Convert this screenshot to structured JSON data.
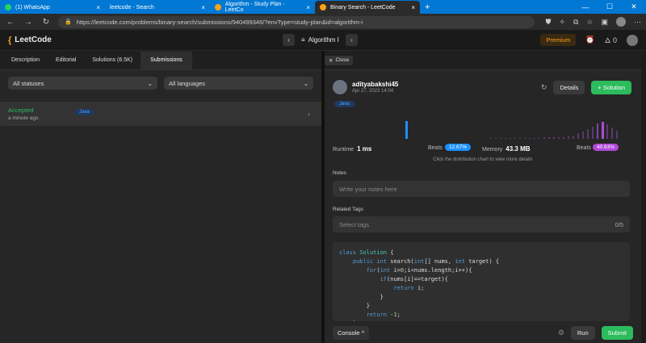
{
  "browser": {
    "tabs": [
      {
        "title": "(1) WhatsApp"
      },
      {
        "title": "leetcode - Search"
      },
      {
        "title": "Algorithm - Study Plan - LeetCo"
      },
      {
        "title": "Binary Search - LeetCode"
      }
    ],
    "url": "https://leetcode.com/problems/binary-search/submissions/940499346/?envType=study-plan&id=algorithm-i"
  },
  "header": {
    "logo": "LeetCode",
    "plan_title": "Algorithm I",
    "premium": "Premium",
    "streak": "0"
  },
  "left": {
    "tabs": [
      "Description",
      "Editorial",
      "Solutions (6.5K)",
      "Submissions"
    ],
    "filters": {
      "status": "All statuses",
      "language": "All languages"
    },
    "submission": {
      "status": "Accepted",
      "time": "a minute ago",
      "language": "Java"
    }
  },
  "right": {
    "close_label": "Close",
    "user": {
      "name": "adityabakshi45",
      "date": "Apr 27, 2023 14:04"
    },
    "details_label": "Details",
    "solution_label": "+ Solution",
    "language": "Java",
    "runtime": {
      "label": "Runtime",
      "value": "1 ms",
      "beats_label": "Beats",
      "beats": "12.67%"
    },
    "memory": {
      "label": "Memory",
      "value": "43.3 MB",
      "beats_label": "Beats",
      "beats": "40.63%"
    },
    "hint": "Click the distribution chart to view more details",
    "notes_label": "Notes",
    "notes_placeholder": "Write your notes here",
    "tags_label": "Related Tags",
    "tags_placeholder": "Select tags",
    "tags_count": "0/5",
    "console_label": "Console ^",
    "run_label": "Run",
    "submit_label": "Submit"
  },
  "code_lines": [
    "class Solution {",
    "    public int search(int[] nums, int target) {",
    "        for(int i=0;i<nums.length;i++){",
    "            if(nums[i]==target){",
    "                return i;",
    "            }",
    "        }",
    "        return -1;",
    "    }"
  ],
  "colors": {
    "accent": "#ffa116",
    "green": "#2cbb5d",
    "blue": "#1a90ff",
    "purple": "#b048d8"
  }
}
